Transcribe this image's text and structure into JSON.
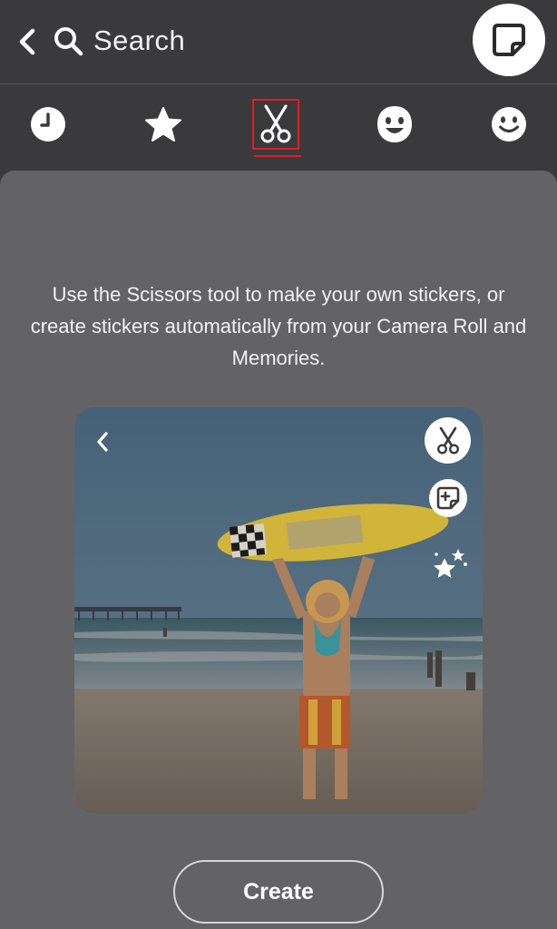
{
  "header": {
    "search_label": "Search",
    "back_icon": "chevron-left-icon",
    "search_icon": "search-icon",
    "sticker_button_icon": "sticker-icon"
  },
  "tabs": [
    {
      "icon": "clock-icon",
      "name": "recent"
    },
    {
      "icon": "star-icon",
      "name": "favorites"
    },
    {
      "icon": "scissors-icon",
      "name": "scissors",
      "selected": true
    },
    {
      "icon": "bitmoji-face-icon",
      "name": "bitmoji"
    },
    {
      "icon": "smiley-icon",
      "name": "emoji"
    }
  ],
  "panel": {
    "description": "Use the Scissors tool to make your own stickers, or create stickers automatically from your Camera Roll and Memories.",
    "create_label": "Create"
  },
  "colors": {
    "background": "#3a3a3c",
    "panel": "#636366",
    "selection": "#e41c24"
  }
}
